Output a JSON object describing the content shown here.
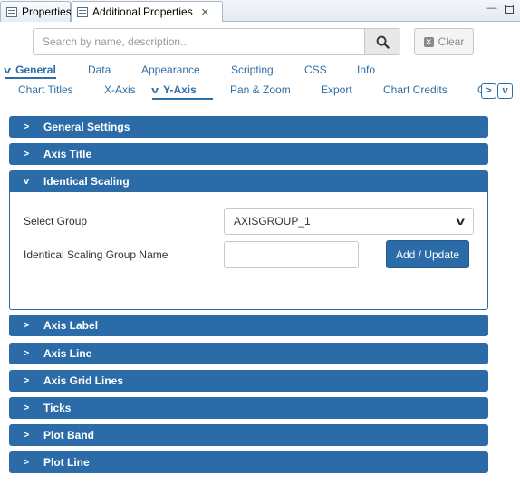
{
  "view_tabs": [
    {
      "label": "Properties",
      "icon": "properties-view-icon"
    },
    {
      "label": "Additional Properties",
      "icon": "properties-view-icon",
      "close": "✕"
    }
  ],
  "window_controls": {
    "minimize": "—",
    "maximize": "□"
  },
  "search": {
    "placeholder": "Search by name, description...",
    "value": "",
    "button_icon": "search-icon"
  },
  "clear_button": {
    "label": "Clear",
    "icon": "clear-icon"
  },
  "main_tabs": [
    {
      "label": "General",
      "active": true
    },
    {
      "label": "Data"
    },
    {
      "label": "Appearance"
    },
    {
      "label": "Scripting"
    },
    {
      "label": "CSS"
    },
    {
      "label": "Info"
    }
  ],
  "sub_tabs": [
    {
      "label": "Chart Titles"
    },
    {
      "label": "X-Axis"
    },
    {
      "label": "Y-Axis",
      "active": true
    },
    {
      "label": "Pan & Zoom"
    },
    {
      "label": "Export"
    },
    {
      "label": "Chart Credits"
    },
    {
      "label": "C"
    }
  ],
  "sections": [
    {
      "label": "General Settings",
      "open": false
    },
    {
      "label": "Axis Title",
      "open": false
    },
    {
      "label": "Identical Scaling",
      "open": true
    },
    {
      "label": "Axis Label",
      "open": false
    },
    {
      "label": "Axis Line",
      "open": false
    },
    {
      "label": "Axis Grid Lines",
      "open": false
    },
    {
      "label": "Ticks",
      "open": false
    },
    {
      "label": "Plot Band",
      "open": false
    },
    {
      "label": "Plot Line",
      "open": false
    }
  ],
  "identical_scaling": {
    "select_group_label": "Select Group",
    "select_group_value": "AXISGROUP_1",
    "group_name_label": "Identical Scaling Group Name",
    "group_name_value": "",
    "add_update_label": "Add / Update"
  },
  "colors": {
    "accent": "#2b6ca8",
    "link": "#2e6ea6"
  }
}
